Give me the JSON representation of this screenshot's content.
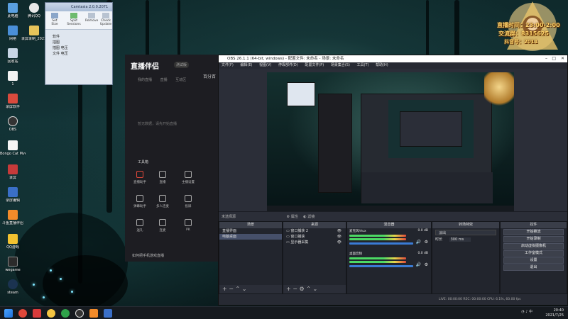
{
  "desktop": {
    "icons": [
      {
        "label": "此电脑"
      },
      {
        "label": "腾讯QQ"
      },
      {
        "label": "网络"
      },
      {
        "label": "录屏录制_20210725"
      },
      {
        "label": "回收站"
      },
      {
        "label": "1"
      },
      {
        "label": "录屏软件"
      },
      {
        "label": "OBS"
      },
      {
        "label": "Bongo Cat Mver - St..."
      },
      {
        "label": "录屏"
      },
      {
        "label": "录屏编辑"
      },
      {
        "label": "斗鱼直播伴侣"
      },
      {
        "label": "QQ游戏"
      },
      {
        "label": "wegame"
      },
      {
        "label": "steam"
      }
    ]
  },
  "camtasia": {
    "title": "Camtasia 2.0.0.2071",
    "ribbon": {
      "btn1": "Set Size",
      "btn2": "Split Sessions",
      "btn3": "Remove",
      "btn4": "Check Update"
    },
    "tree": [
      "软件",
      "插图",
      "插图 电压",
      "文件 电压"
    ]
  },
  "zhibo": {
    "logo": "直播伴侣",
    "version": "测试版",
    "tabs": [
      "我的直播",
      "直播",
      "互动区"
    ],
    "empty": "暂无数据，请先开始直播",
    "tools_title": "工具箱",
    "tools": [
      "直播助手",
      "直播",
      "主播设置",
      "弹幕助手",
      "多人连麦",
      "投屏",
      "送礼",
      "连麦",
      "PK"
    ],
    "footer": "如何把手机游戏直播",
    "side_label": "百分百"
  },
  "obs": {
    "title": "OBS 26.1.1 (64-bit, windows) - 配置文件: 未命名 - 场景: 未命名",
    "menu": [
      "文件(F)",
      "编辑(E)",
      "视图(V)",
      "停靠部件(D)",
      "配置文件(P)",
      "场景集合(S)",
      "工具(T)",
      "帮助(H)"
    ],
    "sub_bar": {
      "label": "未选择源",
      "props": "属性",
      "filters": "滤镜"
    },
    "docks": {
      "scenes": {
        "title": "场景",
        "items": [
          "直播界面",
          "电脑桌面"
        ]
      },
      "sources": {
        "title": "来源",
        "items": [
          "窗口捕获 2",
          "窗口捕获",
          "显示器采集"
        ]
      },
      "mixer": {
        "title": "混音器",
        "ch1": "麦克风/Aux",
        "ch2": "桌面音频",
        "db1": "0.0 dB",
        "db2": "0.0 dB"
      },
      "transitions": {
        "title": "转场特效",
        "type": "淡出",
        "duration_label": "时长",
        "duration": "300 ms"
      },
      "controls": {
        "title": "控件",
        "buttons": [
          "开始推流",
          "开始录制",
          "启动虚拟摄像机",
          "工作室模式",
          "设置",
          "退出"
        ]
      }
    },
    "status": "LIVE: 00:00:00  REC: 00:00:00  CPU: 6.1%, 60.00 fps"
  },
  "overlay": {
    "line1": "直播时间：23:00-2:00",
    "line2": "交流群：8315625",
    "line3": "抖音号：2011"
  },
  "taskbar": {
    "time": "20:40",
    "date": "2021/7/25",
    "lang": "中"
  },
  "colors": {
    "accent_red": "#e0483a",
    "obs_bg": "#2b2e38",
    "meter_green": "#4cd964",
    "meter_blue": "#3a7bd5"
  }
}
